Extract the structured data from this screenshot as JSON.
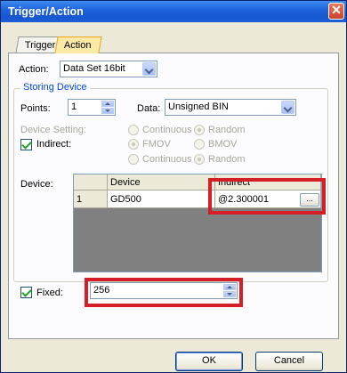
{
  "window": {
    "title": "Trigger/Action",
    "close_glyph": "✕"
  },
  "tabs": [
    {
      "label": "Trigger"
    },
    {
      "label": "Action"
    }
  ],
  "action": {
    "label": "Action:",
    "value": "Data Set 16bit"
  },
  "storing_device": {
    "title": "Storing Device",
    "points_label": "Points:",
    "points_value": "1",
    "data_label": "Data:",
    "data_value": "Unsigned BIN",
    "device_setting_label": "Device Setting:",
    "indirect_label": "Indirect:",
    "radio_rows": [
      {
        "left": "Continuous",
        "right": "Random"
      },
      {
        "left": "FMOV",
        "right": "BMOV"
      },
      {
        "left": "Continuous",
        "right": "Random"
      }
    ]
  },
  "device_table": {
    "label": "Device:",
    "columns": [
      "Device",
      "Indirect"
    ],
    "rows": [
      {
        "index": "1",
        "device": "GD500",
        "indirect": "@2.300001"
      }
    ],
    "browse_label": "..."
  },
  "fixed": {
    "label": "Fixed:",
    "value": "256"
  },
  "buttons": {
    "ok": "OK",
    "cancel": "Cancel"
  },
  "colors": {
    "highlight": "#d41f26",
    "titlebar": "#1f64dd",
    "group_title": "#0046d5"
  }
}
